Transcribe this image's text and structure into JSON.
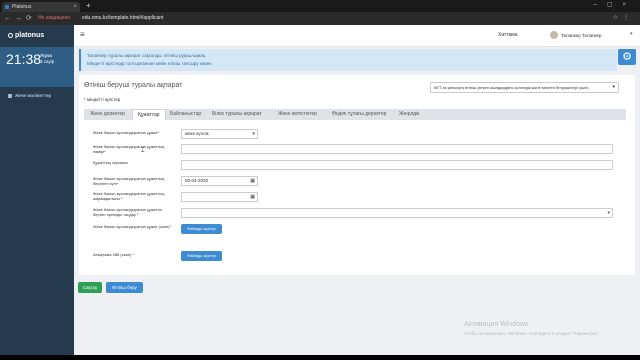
{
  "browser": {
    "tab_title": "Platonus",
    "new_tab": "+",
    "secure_label": "Не защищено",
    "url": "edu.nmu.kz/template.html#/applicant"
  },
  "sidebar": {
    "logo": "platonus",
    "clock": "21:38",
    "day": "Жұма",
    "week": "3 сауір",
    "nav": [
      {
        "label": "Жеке мәліметтер"
      }
    ]
  },
  "header": {
    "menu_item": "Хаттама",
    "user_name": "Талапкер Талапкер"
  },
  "alert": {
    "line1": "Талапкер туралы ақпарат сақталды. Өтініш рұқсылымақ.",
    "line2": "Міндетті өрістерді толтырғаннан кейін өтініш тапсыру керек"
  },
  "form": {
    "title": "Өтініш беруші туралы ақпарат",
    "mode_select": "КЕТ-ға қатысуға өтініш (өткен жылдардағы колледж және мектеп бітірушілері үшін)",
    "required_note": "* міндетті өрістер",
    "tabs": [
      {
        "label": "Жеке деректер",
        "active": false
      },
      {
        "label": "Құжаттар",
        "active": true
      },
      {
        "label": "Байланыстар",
        "active": false
      },
      {
        "label": "Білім туралы ақпарат",
        "active": false
      },
      {
        "label": "Жеке жетістіктер",
        "active": false
      },
      {
        "label": "Өңірлі тұлағы деректер",
        "active": false
      },
      {
        "label": "Жеңілдік",
        "active": false
      }
    ],
    "fields": {
      "doc_type_label": "Жеке басын куәландыратын құжат*",
      "doc_type_value": "жеке куәлік",
      "doc_number_label": "Жеке басын куәландыратын құжаттың нөмірі*",
      "doc_number_value": "",
      "doc_series_label": "Құжаттың сериясы",
      "doc_series_value": "",
      "doc_issue_date_label": "Жеке басын куәландыратын құжаттың берілген күні*",
      "doc_issue_date_value": "00-04-2020",
      "doc_expiry_label": "Жеке басын куәландыратын құжаттың жарамдылығы *",
      "doc_expiry_value": "",
      "doc_issuer_label": "Жеке басын куәландыратын құжатты берген органды таңдау *",
      "doc_issuer_value": "",
      "doc_scan_label": "Жеке басын куәландыратын құжат (скан)*",
      "doc_scan_button": "Файлды жүктеу",
      "form086_label": "Анықтама 086 (скан) *",
      "form086_button": "Файлды жүктеу"
    },
    "save_button": "Сақтау",
    "submit_button": "Өтініш беру"
  },
  "watermark": {
    "line1": "Активация Windows",
    "line2": "Чтобы активировать Windows, перейдите в раздел \"Параметры\"."
  }
}
